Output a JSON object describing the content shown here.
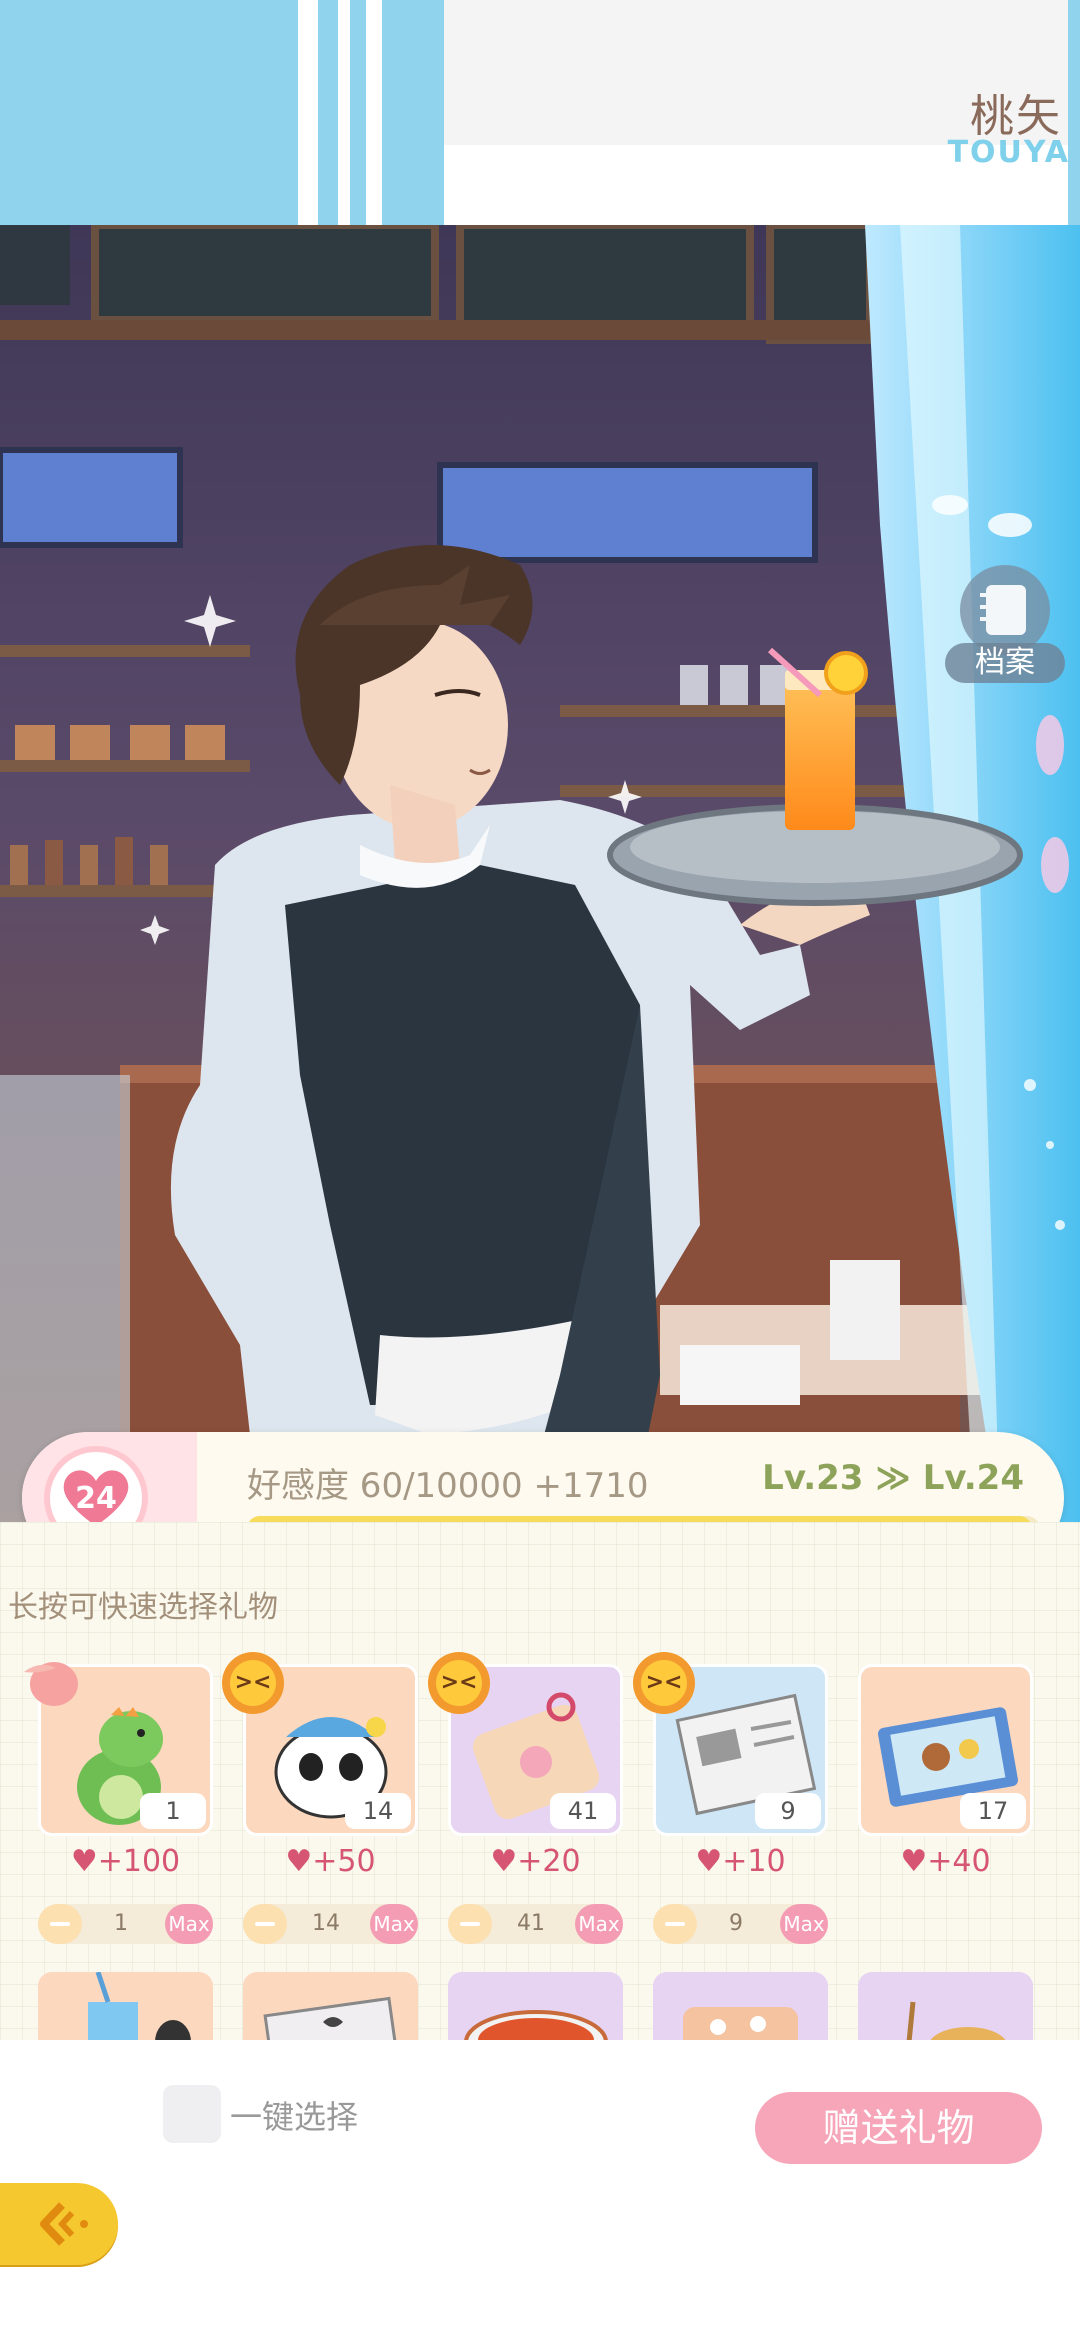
{
  "header": {
    "character_name": "桃矢",
    "character_roman": "TOUYA"
  },
  "profile_button": {
    "label": "档案",
    "icon": "notebook-icon"
  },
  "affection": {
    "level_heart": "24",
    "label": "好感度 60/10000 +1710",
    "level_change": "Lv.23 ≫ Lv.24",
    "progress_fraction": 0.99
  },
  "gift_section": {
    "hint": "长按可快速选择礼物"
  },
  "gifts": [
    {
      "name": "dinosaur-plush",
      "count": "1",
      "value": "+100",
      "select": "1",
      "max": "Max",
      "badge": "peach-icon"
    },
    {
      "name": "panda-plush",
      "count": "14",
      "value": "+50",
      "select": "14",
      "max": "Max",
      "badge": "laugh-emoji-icon"
    },
    {
      "name": "omamori-charm",
      "count": "41",
      "value": "+20",
      "select": "41",
      "max": "Max",
      "badge": "laugh-emoji-icon"
    },
    {
      "name": "newspaper",
      "count": "9",
      "value": "+10",
      "select": "9",
      "max": "Max",
      "badge": "laugh-emoji-icon"
    },
    {
      "name": "picture-book",
      "count": "17",
      "value": "+40",
      "select": "",
      "max": "",
      "badge": ""
    }
  ],
  "bottom_bar": {
    "select_all_label": "一键选择",
    "send_label": "赠送礼物"
  },
  "colors": {
    "accent_pink": "#f6a6b8",
    "level_green": "#8ea35a",
    "stripe_blue": "#8fd3ec",
    "back_yellow": "#f6c830"
  }
}
